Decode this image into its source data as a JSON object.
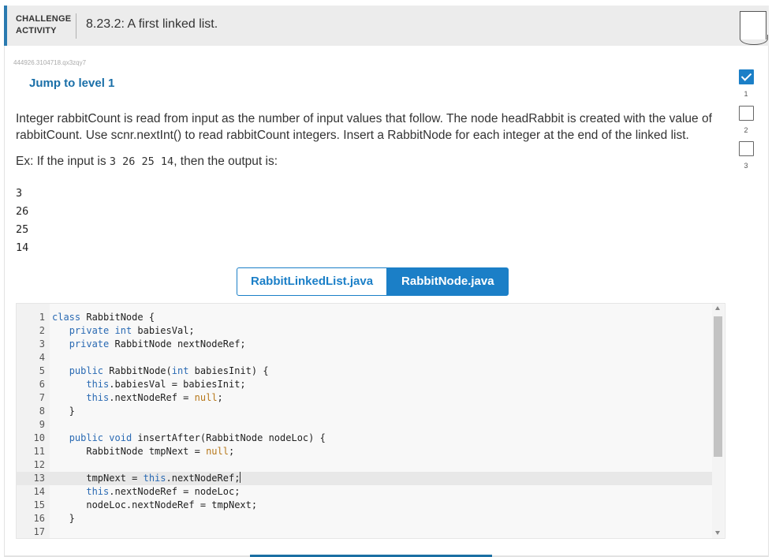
{
  "header": {
    "label_line1": "CHALLENGE",
    "label_line2": "ACTIVITY",
    "title": "8.23.2: A first linked list."
  },
  "activity_id": "444926.3104718.qx3zqy7",
  "jump_label": "Jump to level 1",
  "levels": [
    {
      "label": "1",
      "completed": true
    },
    {
      "label": "2",
      "completed": false
    },
    {
      "label": "3",
      "completed": false
    }
  ],
  "description": "Integer rabbitCount is read from input as the number of input values that follow. The node headRabbit is created with the value of rabbitCount. Use scnr.nextInt() to read rabbitCount integers. Insert a RabbitNode for each integer at the end of the linked list.",
  "example": {
    "prefix": "Ex: If the input is ",
    "input": "3 26 25 14",
    "suffix": ", then the output is:"
  },
  "output_lines": [
    "3",
    "26",
    "25",
    "14"
  ],
  "tabs": [
    {
      "label": "RabbitLinkedList.java",
      "active": false
    },
    {
      "label": "RabbitNode.java",
      "active": true
    }
  ],
  "code_lines": [
    {
      "n": "1",
      "text": "class RabbitNode {"
    },
    {
      "n": "2",
      "text": "   private int babiesVal;"
    },
    {
      "n": "3",
      "text": "   private RabbitNode nextNodeRef;"
    },
    {
      "n": "4",
      "text": ""
    },
    {
      "n": "5",
      "text": "   public RabbitNode(int babiesInit) {"
    },
    {
      "n": "6",
      "text": "      this.babiesVal = babiesInit;"
    },
    {
      "n": "7",
      "text": "      this.nextNodeRef = null;"
    },
    {
      "n": "8",
      "text": "   }"
    },
    {
      "n": "9",
      "text": ""
    },
    {
      "n": "10",
      "text": "   public void insertAfter(RabbitNode nodeLoc) {"
    },
    {
      "n": "11",
      "text": "      RabbitNode tmpNext = null;"
    },
    {
      "n": "12",
      "text": ""
    },
    {
      "n": "13",
      "text": "      tmpNext = this.nextNodeRef;"
    },
    {
      "n": "14",
      "text": "      this.nextNodeRef = nodeLoc;"
    },
    {
      "n": "15",
      "text": "      nodeLoc.nextNodeRef = tmpNext;"
    },
    {
      "n": "16",
      "text": "   }"
    },
    {
      "n": "17",
      "text": ""
    }
  ],
  "active_line": "13",
  "colors": {
    "accent": "#1b7fc7",
    "keyword": "#2a6ab3",
    "literal": "#b7781a"
  }
}
